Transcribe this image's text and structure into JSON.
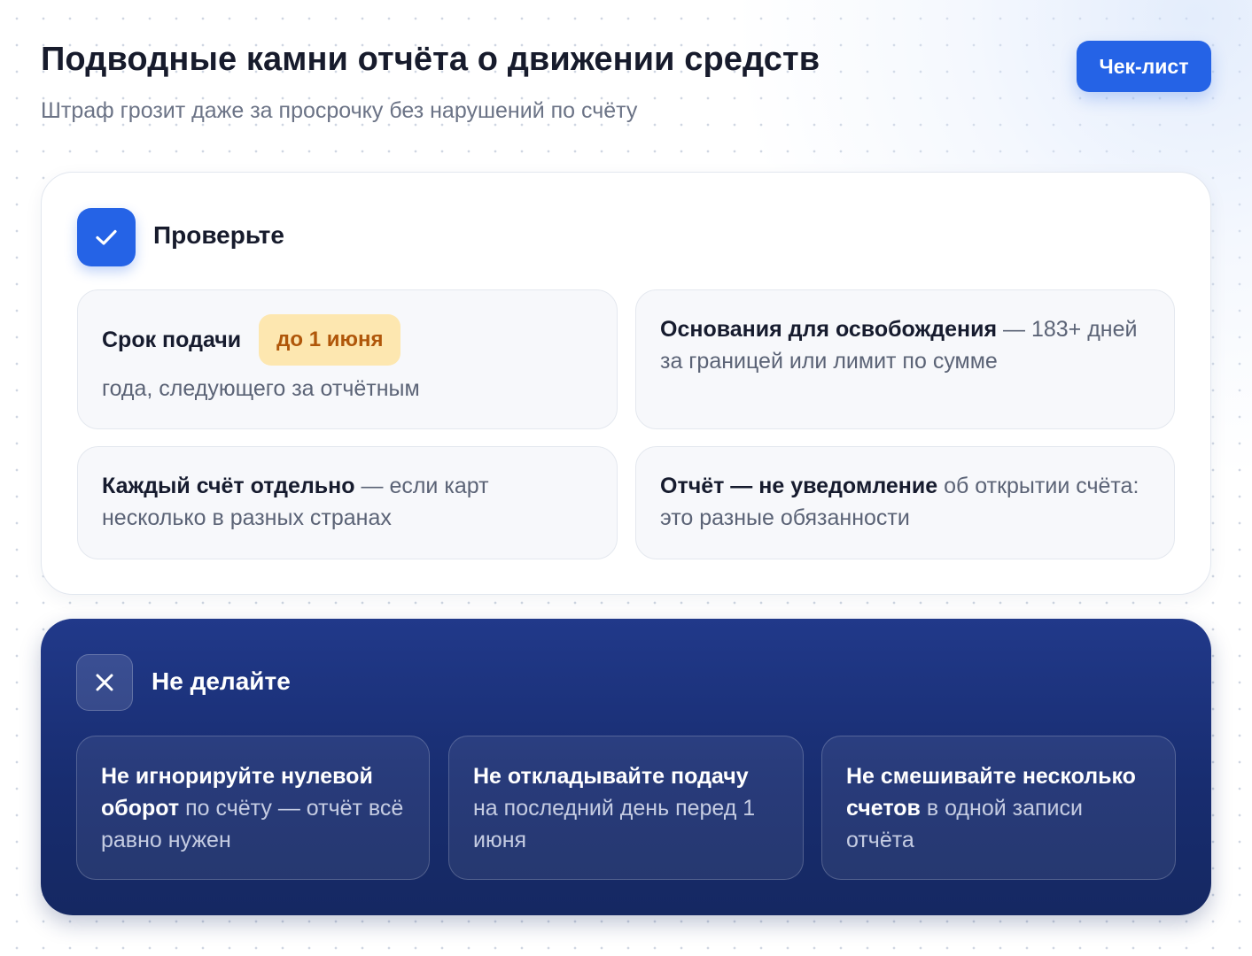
{
  "header": {
    "title": "Подводные камни отчёта о движении средств",
    "subtitle": "Штраф грозит даже за просрочку без нарушений по счёту",
    "checklist_button": "Чек-лист"
  },
  "check_section": {
    "icon": "checkmark-icon",
    "heading": "Проверьте",
    "cards": [
      {
        "title": "Срок подачи",
        "badge": "до 1 июня",
        "text": "года, следующего за отчётным"
      },
      {
        "title": "Основания для освобождения",
        "text": " — 183+ дней за границей или лимит по сумме"
      },
      {
        "title": "Каждый счёт отдельно",
        "text": " — если карт несколько в разных странах"
      },
      {
        "title": "Отчёт — не уведомление",
        "text": " об открытии счёта: это разные обязанности"
      }
    ]
  },
  "dont_section": {
    "icon": "close-icon",
    "heading": "Не делайте",
    "cards": [
      {
        "title": "Не игнорируйте нулевой оборот",
        "text": " по счёту — отчёт всё равно нужен"
      },
      {
        "title": "Не откладывайте подачу",
        "text": " на последний день перед 1 июня"
      },
      {
        "title": "Не смешивайте несколько счетов",
        "text": " в одной записи отчёта"
      }
    ]
  },
  "colors": {
    "accent": "#2563e6",
    "badge_bg": "#fde7b0",
    "badge_text": "#b0570a",
    "dark_panel": "#1b3178",
    "title_text": "#171b2c",
    "muted_text": "#6b7386"
  }
}
